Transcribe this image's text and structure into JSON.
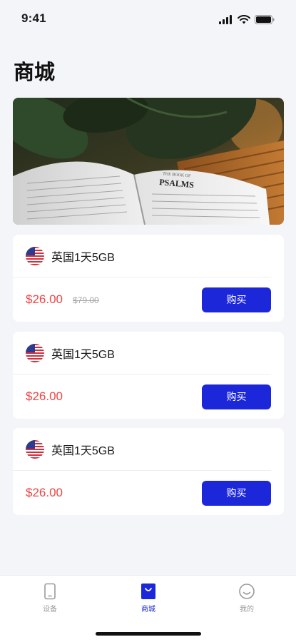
{
  "status_bar": {
    "time": "9:41"
  },
  "page": {
    "title": "商城"
  },
  "banner": {
    "book_text": "PSALMS",
    "book_header": "THE BOOK OF"
  },
  "products": [
    {
      "flag": "us-flag-icon",
      "title": "英国1天5GB",
      "price": "$26.00",
      "original_price": "$79.00",
      "buy_label": "购买"
    },
    {
      "flag": "us-flag-icon",
      "title": "英国1天5GB",
      "price": "$26.00",
      "original_price": "",
      "buy_label": "购买"
    },
    {
      "flag": "us-flag-icon",
      "title": "英国1天5GB",
      "price": "$26.00",
      "original_price": "",
      "buy_label": "购买"
    }
  ],
  "tabs": [
    {
      "label": "设备",
      "icon": "device-icon",
      "active": false
    },
    {
      "label": "商城",
      "icon": "shop-bag-icon",
      "active": true
    },
    {
      "label": "我的",
      "icon": "smile-icon",
      "active": false
    }
  ],
  "colors": {
    "accent": "#1c27d9",
    "price": "#ef4444",
    "background": "#f4f5f9"
  }
}
